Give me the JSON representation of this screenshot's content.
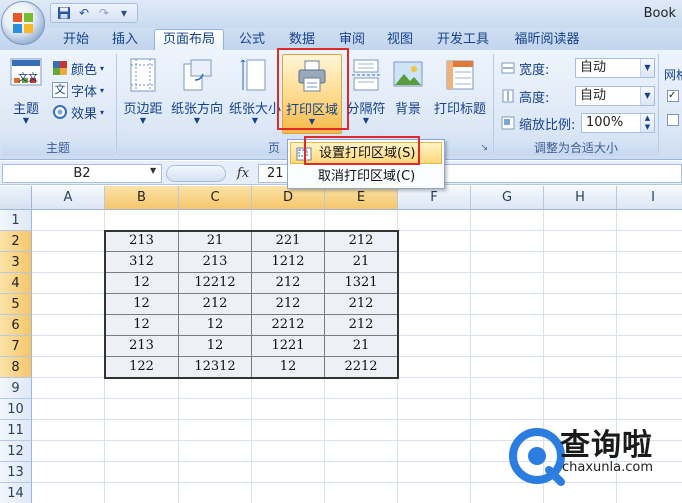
{
  "window": {
    "title_partial": "Book",
    "qat_items": [
      {
        "icon": "save-icon",
        "glyph": "💾"
      },
      {
        "icon": "undo-icon",
        "glyph": "↶"
      },
      {
        "icon": "redo-icon",
        "glyph": "↷"
      },
      {
        "icon": "customize-qat-icon",
        "glyph": "▾"
      }
    ]
  },
  "tabs": [
    {
      "label": "开始"
    },
    {
      "label": "插入"
    },
    {
      "label": "页面布局",
      "active": true
    },
    {
      "label": "公式"
    },
    {
      "label": "数据"
    },
    {
      "label": "审阅"
    },
    {
      "label": "视图"
    },
    {
      "label": "开发工具"
    },
    {
      "label": "福昕阅读器"
    }
  ],
  "ribbon": {
    "theme_group": {
      "label": "主题",
      "theme_button": "主题",
      "theme_icon_text": "文文",
      "colors": "颜色",
      "fonts": "字体",
      "effects": "效果"
    },
    "page_setup_group": {
      "label_partial": "页",
      "margins": "页边距",
      "orientation": "纸张方向",
      "size": "纸张大小",
      "print_area": "打印区域",
      "breaks": "分隔符",
      "background": "背景",
      "print_titles": "打印标题"
    },
    "scale_group": {
      "label": "调整为合适大小",
      "width_label": "宽度:",
      "width_value": "自动",
      "height_label": "高度:",
      "height_value": "自动",
      "scale_label": "缩放比例:",
      "scale_value": "100%"
    },
    "sheet_options_partial": "网格"
  },
  "print_area_menu": {
    "items": [
      {
        "label": "设置打印区域(S)",
        "highlighted": true
      },
      {
        "label": "取消打印区域(C)",
        "highlighted": false
      }
    ]
  },
  "formula_bar": {
    "name_box": "B2",
    "fx": "fx",
    "value": "21"
  },
  "sheet": {
    "columns": [
      "A",
      "B",
      "C",
      "D",
      "E",
      "F",
      "G",
      "H",
      "I"
    ],
    "selected_columns": [
      "B",
      "C",
      "D",
      "E"
    ],
    "rows": [
      "1",
      "2",
      "3",
      "4",
      "5",
      "6",
      "7",
      "8",
      "9",
      "10",
      "11",
      "12",
      "13",
      "14"
    ],
    "selected_rows": [
      "2",
      "3",
      "4",
      "5",
      "6",
      "7",
      "8"
    ],
    "data": [
      [
        "213",
        "21",
        "221",
        "212"
      ],
      [
        "312",
        "213",
        "1212",
        "21"
      ],
      [
        "12",
        "12212",
        "212",
        "1321"
      ],
      [
        "12",
        "212",
        "212",
        "212"
      ],
      [
        "12",
        "12",
        "2212",
        "212"
      ],
      [
        "213",
        "12",
        "1221",
        "21"
      ],
      [
        "122",
        "12312",
        "12",
        "2212"
      ]
    ]
  },
  "watermark": {
    "text": "查询啦",
    "url": "chaxunla.com"
  },
  "colors": {
    "highlight_red": "#e02a2a",
    "accent_blue": "#15428b",
    "selected_header": "#f5c66a"
  }
}
